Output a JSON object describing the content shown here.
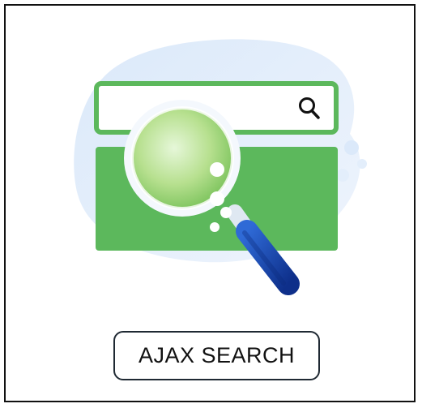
{
  "button": {
    "label": "AJAX SEARCH"
  },
  "icons": {
    "search": "search-icon",
    "magnifier": "magnifying-glass-icon"
  },
  "colors": {
    "green": "#5cb85c",
    "blob": "#e8f1fb",
    "handle": "#1d4fb8",
    "border": "#111111"
  }
}
